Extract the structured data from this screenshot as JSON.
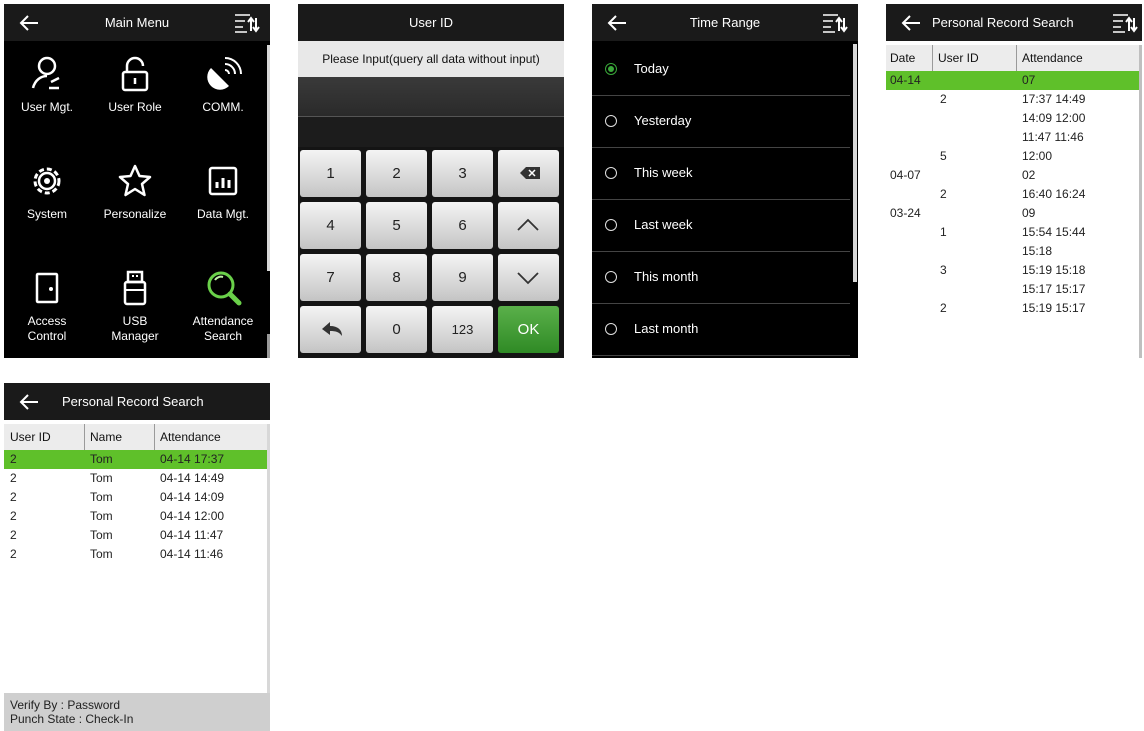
{
  "colors": {
    "accent_green": "#5fc02a",
    "header_bg": "#1a1a1a",
    "ok_green": "#2f8a25"
  },
  "main_menu": {
    "title": "Main Menu",
    "items": [
      {
        "label": "User Mgt.",
        "icon": "user-icon"
      },
      {
        "label": "User Role",
        "icon": "lock-icon"
      },
      {
        "label": "COMM.",
        "icon": "satellite-dish-icon"
      },
      {
        "label": "System",
        "icon": "gear-icon"
      },
      {
        "label": "Personalize",
        "icon": "star-icon"
      },
      {
        "label": "Data Mgt.",
        "icon": "bar-chart-icon"
      },
      {
        "label": "Access\nControl",
        "icon": "door-icon"
      },
      {
        "label": "USB\nManager",
        "icon": "usb-icon"
      },
      {
        "label": "Attendance\nSearch",
        "icon": "magnifier-icon"
      }
    ]
  },
  "user_id": {
    "title": "User ID",
    "prompt": "Please Input(query all data without input)",
    "input_value": "",
    "keys": [
      "1",
      "2",
      "3",
      "backspace",
      "4",
      "5",
      "6",
      "up",
      "7",
      "8",
      "9",
      "down",
      "back",
      "0",
      "123",
      "OK"
    ],
    "key_labels": {
      "k1": "1",
      "k2": "2",
      "k3": "3",
      "k4": "4",
      "k5": "5",
      "k6": "6",
      "k7": "7",
      "k8": "8",
      "k9": "9",
      "k0": "0",
      "k123": "123",
      "ok": "OK"
    }
  },
  "time_range": {
    "title": "Time Range",
    "options": [
      {
        "label": "Today",
        "selected": true
      },
      {
        "label": "Yesterday",
        "selected": false
      },
      {
        "label": "This week",
        "selected": false
      },
      {
        "label": "Last week",
        "selected": false
      },
      {
        "label": "This month",
        "selected": false
      },
      {
        "label": "Last month",
        "selected": false
      }
    ]
  },
  "record_by_date": {
    "title": "Personal Record Search",
    "columns": [
      "Date",
      "User ID",
      "Attendance"
    ],
    "rows": [
      {
        "date": "04-14",
        "user": "",
        "att": "07",
        "selected": true
      },
      {
        "date": "",
        "user": "2",
        "att": "17:37 14:49"
      },
      {
        "date": "",
        "user": "",
        "att": "14:09 12:00"
      },
      {
        "date": "",
        "user": "",
        "att": "11:47 11:46"
      },
      {
        "date": "",
        "user": "5",
        "att": "12:00"
      },
      {
        "date": "04-07",
        "user": "",
        "att": "02"
      },
      {
        "date": "",
        "user": "2",
        "att": "16:40 16:24"
      },
      {
        "date": "03-24",
        "user": "",
        "att": "09"
      },
      {
        "date": "",
        "user": "1",
        "att": "15:54 15:44"
      },
      {
        "date": "",
        "user": "",
        "att": "15:18"
      },
      {
        "date": "",
        "user": "3",
        "att": "15:19 15:18"
      },
      {
        "date": "",
        "user": "",
        "att": "15:17 15:17"
      },
      {
        "date": "",
        "user": "2",
        "att": "15:19 15:17"
      }
    ]
  },
  "record_by_user": {
    "title": "Personal Record Search",
    "columns": [
      "User ID",
      "Name",
      "Attendance"
    ],
    "rows": [
      {
        "user": "2",
        "name": "Tom",
        "att": "04-14 17:37",
        "selected": true
      },
      {
        "user": "2",
        "name": "Tom",
        "att": "04-14 14:49"
      },
      {
        "user": "2",
        "name": "Tom",
        "att": "04-14 14:09"
      },
      {
        "user": "2",
        "name": "Tom",
        "att": "04-14 12:00"
      },
      {
        "user": "2",
        "name": "Tom",
        "att": "04-14 11:47"
      },
      {
        "user": "2",
        "name": "Tom",
        "att": "04-14 11:46"
      }
    ],
    "verify_by": "Verify By : Password",
    "punch_state": "Punch State : Check-In"
  }
}
